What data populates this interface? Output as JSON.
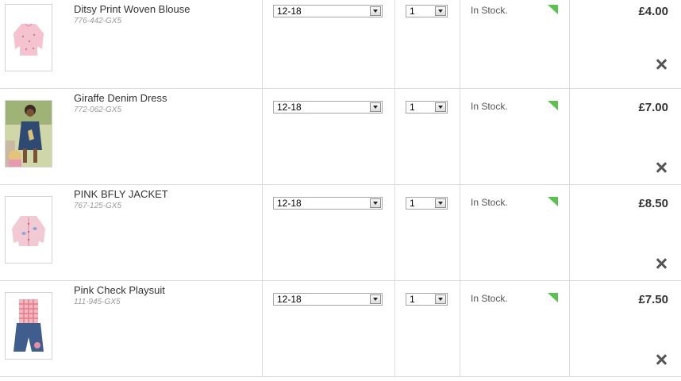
{
  "basket": {
    "items": [
      {
        "name": "Ditsy Print Woven Blouse",
        "sku": "776-442-GX5",
        "size": "12-18",
        "qty": "1",
        "stock": "In Stock.",
        "price": "£4.00",
        "image_icon": "pink-blouse-image"
      },
      {
        "name": "Giraffe Denim Dress",
        "sku": "772-062-GX5",
        "size": "12-18",
        "qty": "1",
        "stock": "In Stock.",
        "price": "£7.00",
        "image_icon": "denim-dress-photo"
      },
      {
        "name": "PINK BFLY JACKET",
        "sku": "767-125-GX5",
        "size": "12-18",
        "qty": "1",
        "stock": "In Stock.",
        "price": "£8.50",
        "image_icon": "pink-jacket-image"
      },
      {
        "name": "Pink Check Playsuit",
        "sku": "111-945-GX5",
        "size": "12-18",
        "qty": "1",
        "stock": "In Stock.",
        "price": "£7.50",
        "image_icon": "playsuit-image"
      }
    ]
  },
  "colors": {
    "stock_flag": "#5bc24f",
    "divider": "#dcdcdc",
    "sku_text": "#999999"
  },
  "icons": {
    "remove": "close-icon",
    "dropdown": "chevron-down-icon"
  }
}
